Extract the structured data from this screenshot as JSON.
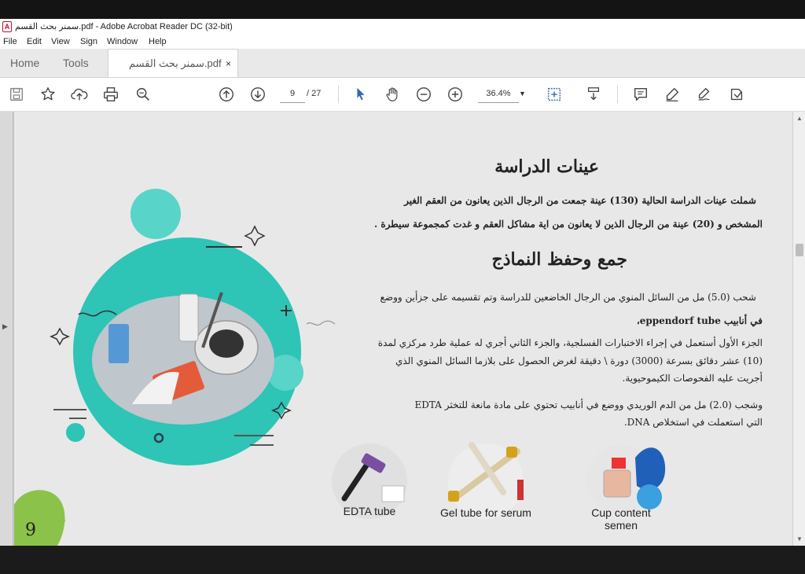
{
  "window": {
    "title": "سمنر بحث القسم.pdf - Adobe Acrobat Reader DC (32-bit)",
    "app_icon_glyph": "A"
  },
  "menu": [
    "File",
    "Edit",
    "View",
    "Sign",
    "Window",
    "Help"
  ],
  "tabs": {
    "home": "Home",
    "tools": "Tools",
    "document": "سمنر بحث القسم.pdf",
    "close_glyph": "×"
  },
  "toolbar": {
    "page_current": "9",
    "page_total": "/ 27",
    "zoom": "36.4%",
    "icons": [
      "save-icon",
      "bookmark-star-icon",
      "upload-icon",
      "print-icon",
      "search-icon",
      "previous-page-icon",
      "next-page-icon",
      "select-cursor-icon",
      "hand-icon",
      "zoom-out-icon",
      "zoom-in-icon",
      "fit-page-icon",
      "scroll-mode-icon",
      "comment-icon",
      "highlight-icon",
      "sign-icon",
      "more-tools-icon"
    ]
  },
  "document": {
    "heading1": "عينات الدراسة",
    "para1_line1": "شملت عينات الدراسة الحالية (130) عينة جمعت من الرجال الذين يعانون من العقم الغير",
    "para1_line2": "المشخص و (20) عينة من الرجال الذين لا يعانون من اية مشاكل العقم و غدت كمجموعة سيطرة .",
    "heading2": "جمع وحفظ النماذج",
    "para2_line1": "شحب (5.0) مل من السائل المنوي من الرجال الخاضعين للدراسة وتم تقسيمه على جزأين ووضع",
    "para2_line2": "في أنابيب eppendorf tube،",
    "para3_line1": "الجزء الأول أستعمل في إجراء الاختبارات الفسلجية، والجزء الثاني أجري له عملية طرد مركزي لمدة",
    "para3_line2": "(10) عشر دقائق بسرعة (3000) دورة \\ دقيقة لغرض الحصول على بلازما السائل المنوي الذي",
    "para3_line3": "أجريت عليه الفحوصات الكيموحيوية.",
    "para4_line1": "وشجب (2.0) مل من الدم الوريدي ووضع في أنابيب تحتوي على مادة مانعة للتخثر EDTA",
    "para4_line2": "التي استعملت في استخلاص DNA.",
    "captions": [
      "EDTA tube",
      "Gel tube for serum",
      "Cup content semen"
    ],
    "page_number_badge": "9"
  },
  "colors": {
    "teal": "#2ec4b6",
    "teal_dark": "#1fa99b",
    "adobe_red": "#c8102e",
    "toolbar_blue": "#2b6cb0"
  }
}
